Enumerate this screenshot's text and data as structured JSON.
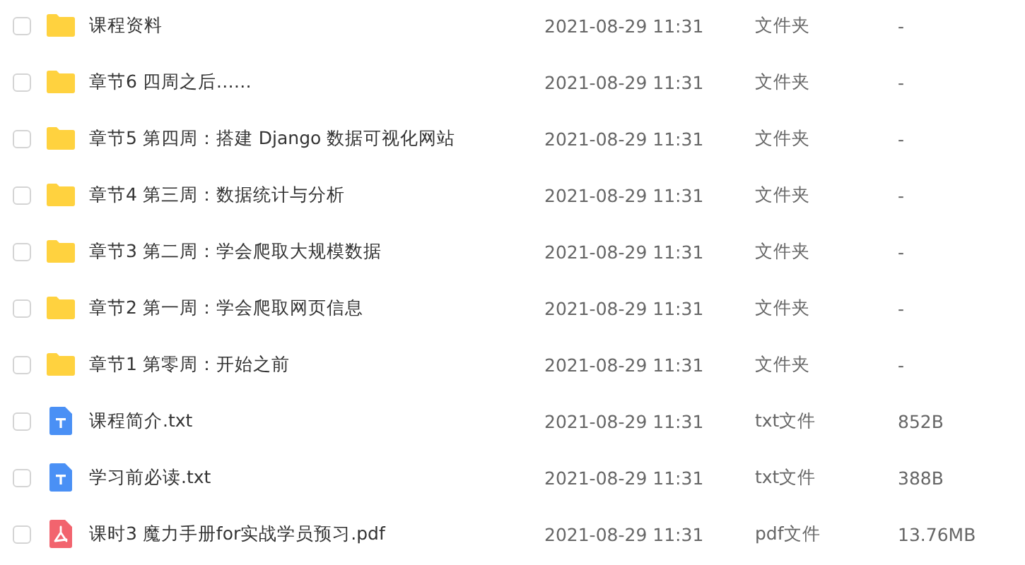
{
  "files": [
    {
      "name": "课程资料",
      "kind": "folder",
      "checked": false,
      "modified": "2021-08-29 11:31",
      "type": "文件夹",
      "size": "-"
    },
    {
      "name": "章节6 四周之后……",
      "kind": "folder",
      "checked": false,
      "modified": "2021-08-29 11:31",
      "type": "文件夹",
      "size": "-"
    },
    {
      "name": "章节5 第四周：搭建 Django 数据可视化网站",
      "kind": "folder",
      "checked": false,
      "modified": "2021-08-29 11:31",
      "type": "文件夹",
      "size": "-"
    },
    {
      "name": "章节4 第三周：数据统计与分析",
      "kind": "folder",
      "checked": false,
      "modified": "2021-08-29 11:31",
      "type": "文件夹",
      "size": "-"
    },
    {
      "name": "章节3 第二周：学会爬取大规模数据",
      "kind": "folder",
      "checked": false,
      "modified": "2021-08-29 11:31",
      "type": "文件夹",
      "size": "-"
    },
    {
      "name": "章节2 第一周：学会爬取网页信息",
      "kind": "folder",
      "checked": false,
      "modified": "2021-08-29 11:31",
      "type": "文件夹",
      "size": "-"
    },
    {
      "name": "章节1 第零周：开始之前",
      "kind": "folder",
      "checked": false,
      "modified": "2021-08-29 11:31",
      "type": "文件夹",
      "size": "-"
    },
    {
      "name": "课程简介.txt",
      "kind": "txt",
      "checked": false,
      "modified": "2021-08-29 11:31",
      "type": "txt文件",
      "size": "852B"
    },
    {
      "name": "学习前必读.txt",
      "kind": "txt",
      "checked": false,
      "modified": "2021-08-29 11:31",
      "type": "txt文件",
      "size": "388B"
    },
    {
      "name": "课时3 魔力手册for实战学员预习.pdf",
      "kind": "pdf",
      "checked": false,
      "modified": "2021-08-29 11:31",
      "type": "pdf文件",
      "size": "13.76MB"
    }
  ]
}
